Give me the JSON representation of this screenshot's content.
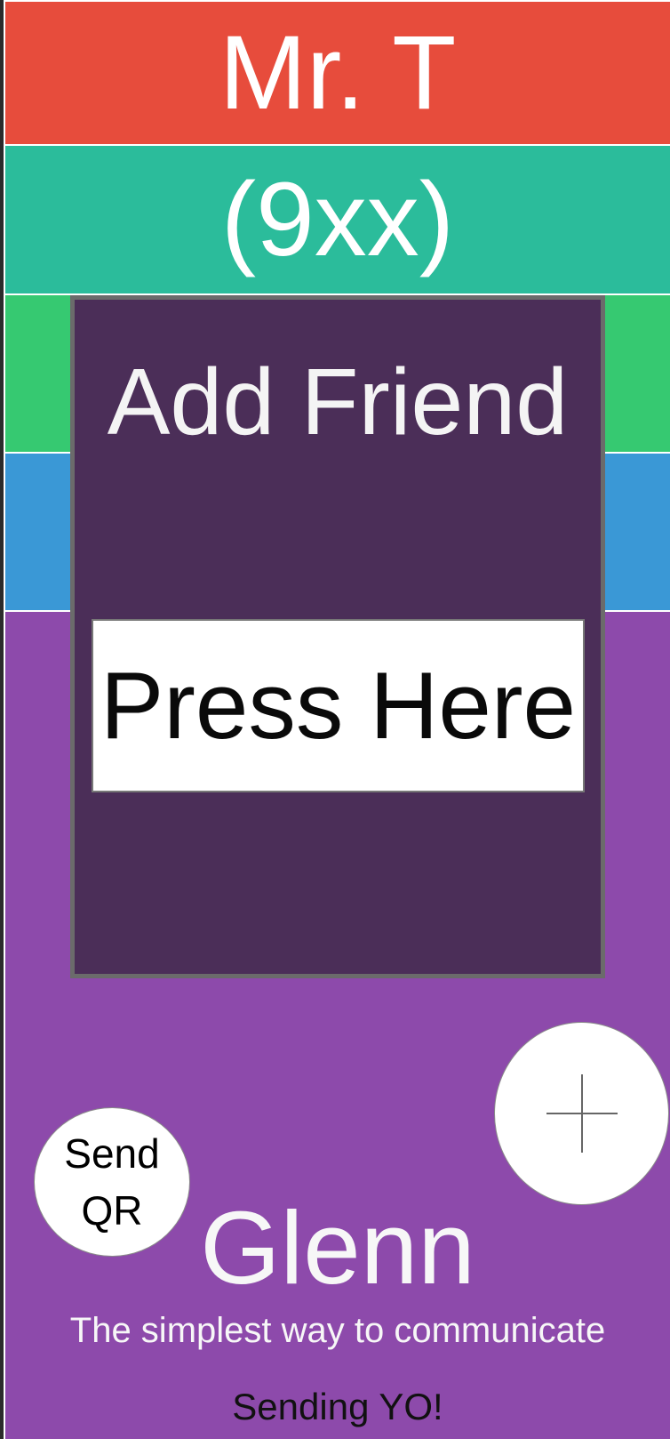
{
  "header": {
    "name": "Mr. T",
    "code": "(9xx)"
  },
  "dialog": {
    "title": "Add Friend",
    "button_label": "Press Here"
  },
  "actions": {
    "send_qr_line1": "Send",
    "send_qr_line2": "QR",
    "add_icon": "plus-icon"
  },
  "footer": {
    "user_name": "Glenn",
    "tagline": "The simplest way to communicate",
    "status": "Sending YO!"
  },
  "colors": {
    "red": "#e74c3c",
    "teal": "#2bbc9b",
    "green": "#36c971",
    "blue": "#3a98d6",
    "purple": "#8d4aab",
    "dialog": "#4b2e58"
  }
}
